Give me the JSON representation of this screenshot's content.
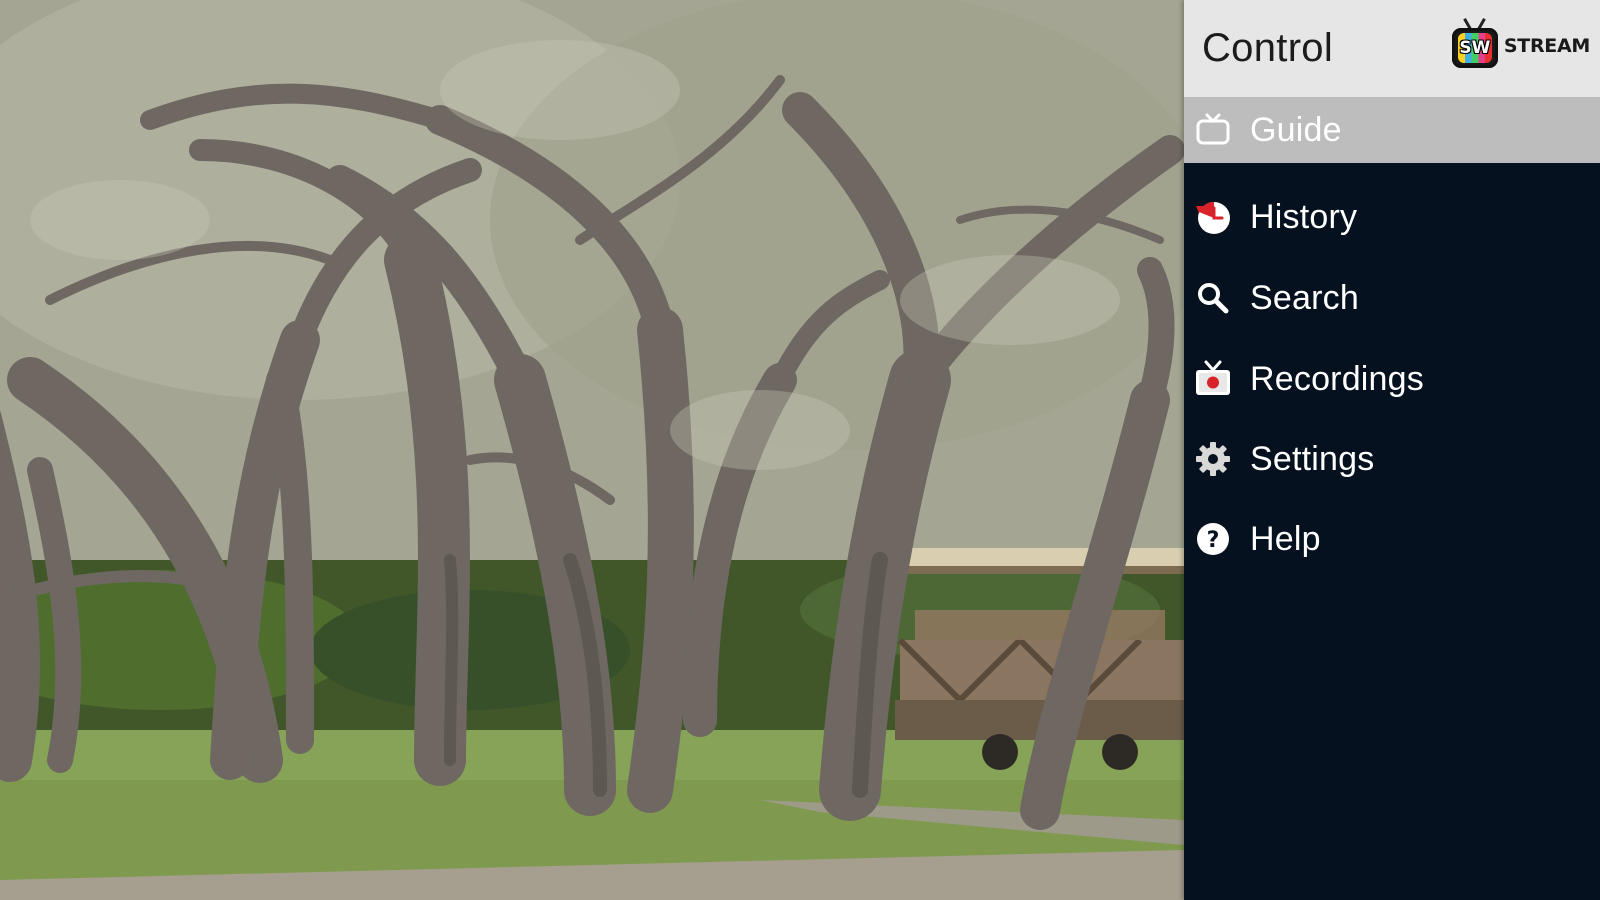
{
  "menu": {
    "title": "Control",
    "brand": {
      "logo_letters": "SW",
      "wordmark": "STREAM"
    },
    "items": [
      {
        "label": "Guide",
        "icon": "tv-icon",
        "selected": true
      },
      {
        "label": "History",
        "icon": "history-clock-icon",
        "selected": false
      },
      {
        "label": "Search",
        "icon": "search-icon",
        "selected": false
      },
      {
        "label": "Recordings",
        "icon": "record-tv-icon",
        "selected": false
      },
      {
        "label": "Settings",
        "icon": "gear-icon",
        "selected": false
      },
      {
        "label": "Help",
        "icon": "help-icon",
        "selected": false
      }
    ]
  },
  "colors": {
    "panel_bg": "#06111f",
    "header_bg": "#e6e6e6",
    "selected_bg": "#bdbdbd",
    "accent_red": "#d8232a"
  }
}
